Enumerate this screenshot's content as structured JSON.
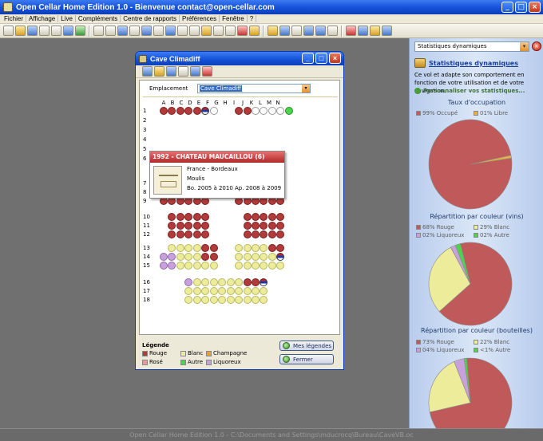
{
  "app": {
    "title": "Open Cellar Home Edition 1.0 - Bienvenue contact@open-cellar.com"
  },
  "menu": [
    "Fichier",
    "Affichage",
    "Live",
    "Compléments",
    "Centre de rapports",
    "Préférences",
    "Fenêtre",
    "?"
  ],
  "status_bar": "Open Cellar Home Edition 1.0 - C:\\Documents and Settings\\mducrocq\\Bureau\\CaveVB.oc",
  "cellar_window": {
    "title": "Cave Climadiff",
    "location_label": "Emplacement",
    "location_value": "Cave Climadiff",
    "columns": [
      "A",
      "B",
      "C",
      "D",
      "E",
      "F",
      "G",
      "H",
      "I",
      "J",
      "K",
      "L",
      "M",
      "N"
    ],
    "rows": [
      "1",
      "2",
      "3",
      "4",
      "5",
      "6",
      "7",
      "8",
      "9",
      "10",
      "11",
      "12",
      "13",
      "14",
      "15",
      "16",
      "17",
      "18"
    ],
    "tooltip": {
      "header": "1992 - CHATEAU MAUCAILLOU (6)",
      "line1": "France - Bordeaux",
      "line2": "Moulis",
      "line3": "Bo. 2005 à 2010 Ap. 2008 à 2009"
    },
    "legend_title": "Légende",
    "legend": [
      {
        "label": "Rouge",
        "color": "#b23a3a"
      },
      {
        "label": "Rosé",
        "color": "#e89a9a"
      },
      {
        "label": "Blanc",
        "color": "#ecec9a"
      },
      {
        "label": "Autre",
        "color": "#4cd44c"
      },
      {
        "label": "Champagne",
        "color": "#e8a030"
      },
      {
        "label": "Liquoreux",
        "color": "#c8a0dc"
      }
    ],
    "btn_legends": "Mes légendes",
    "btn_close": "Fermer"
  },
  "panel": {
    "dropdown": "Statistiques dynamiques",
    "heading": "Statistiques dynamiques",
    "description": "Ce vol et adapte son comportement en fonction de votre utilisation et de votre navigation.",
    "customize": "Personnaliser vos statistiques...",
    "charts": [
      {
        "title": "Taux d'occupation",
        "legend": [
          {
            "label": "99% Occupé",
            "value": 99,
            "color": "#c05a5a"
          },
          {
            "label": "01% Libre",
            "value": 1,
            "color": "#e8b040"
          }
        ]
      },
      {
        "title": "Répartition par couleur (vins)",
        "legend": [
          {
            "label": "68% Rouge",
            "value": 68,
            "color": "#c05a5a"
          },
          {
            "label": "29% Blanc",
            "value": 29,
            "color": "#ecec9a"
          },
          {
            "label": "02% Liquoreux",
            "value": 2,
            "color": "#c8a0dc"
          },
          {
            "label": "02% Autre",
            "value": 2,
            "color": "#4cd44c"
          }
        ]
      },
      {
        "title": "Répartition par couleur (bouteilles)",
        "legend": [
          {
            "label": "73% Rouge",
            "value": 73,
            "color": "#c05a5a"
          },
          {
            "label": "22% Blanc",
            "value": 22,
            "color": "#ecec9a"
          },
          {
            "label": "04% Liquoreux",
            "value": 4,
            "color": "#c8a0dc"
          },
          {
            "label": "<1% Autre",
            "value": 1,
            "color": "#4cd44c"
          }
        ]
      }
    ]
  }
}
